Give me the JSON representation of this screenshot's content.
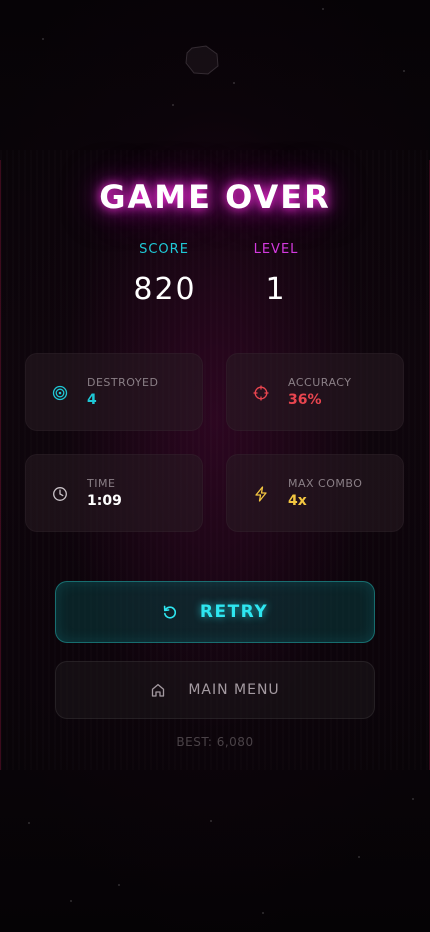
{
  "screen": {
    "title": "GAME OVER"
  },
  "summary": {
    "score_label": "SCORE",
    "score_value": "820",
    "level_label": "LEVEL",
    "level_value": "1"
  },
  "stats": [
    {
      "label": "DESTROYED",
      "value": "4",
      "icon": "target-icon",
      "color": "#1ec8d6"
    },
    {
      "label": "ACCURACY",
      "value": "36%",
      "icon": "crosshair-icon",
      "color": "#e8454f"
    },
    {
      "label": "TIME",
      "value": "1:09",
      "icon": "clock-icon",
      "color": "#ffffff"
    },
    {
      "label": "MAX COMBO",
      "value": "4x",
      "icon": "lightning-icon",
      "color": "#f2c541"
    }
  ],
  "actions": {
    "retry_label": "RETRY",
    "retry_icon": "retry-icon",
    "menu_label": "MAIN MENU",
    "menu_icon": "home-icon"
  },
  "best": "BEST: 6,080",
  "colors": {
    "title_glow": "#ff2ee0",
    "score_label": "#1ec8d6",
    "level_label": "#d43adf",
    "retry_accent": "#2ee6f0"
  }
}
